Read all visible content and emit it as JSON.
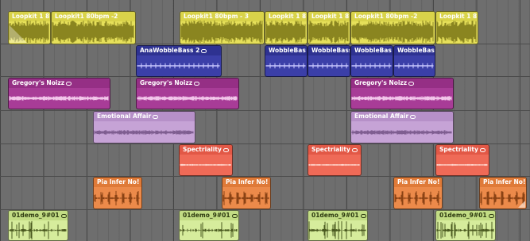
{
  "tracks": [
    {
      "id": "loopkit",
      "color": "#e6e05a",
      "header": "#d9d34a",
      "text": "#ffffff",
      "wave": "#8a8520",
      "waveKind": "dense",
      "regions": [
        {
          "label": "Loopkit 1 8"
        },
        {
          "label": "Loopkit1 80bpm -2"
        },
        {
          "label": "Loopkit1 80bpm - 3"
        },
        {
          "label": "Loopkit 1 8"
        },
        {
          "label": "Loopkit 1 8"
        },
        {
          "label": "Loopkit1 80bpm -2"
        },
        {
          "label": "Loopkit 1 8"
        }
      ]
    },
    {
      "id": "wobble",
      "color": "#3b3fa8",
      "header": "#2e3291",
      "text": "#ffffff",
      "wave": "#c9c9ff",
      "waveKind": "blips",
      "regions": [
        {
          "label": "AnaWobbleBass 2"
        },
        {
          "label": "WobbleBas"
        },
        {
          "label": "WobbleBass"
        },
        {
          "label": "WobbleBas"
        },
        {
          "label": "WobbleBas"
        }
      ]
    },
    {
      "id": "gregory",
      "color": "#a83c97",
      "header": "#952f85",
      "text": "#ffffff",
      "wave": "#f2c6ea",
      "waveKind": "thin",
      "regions": [
        {
          "label": "Gregory's Noizz"
        },
        {
          "label": "Gregory's Noizz"
        },
        {
          "label": "Gregory's Noizz"
        }
      ]
    },
    {
      "id": "emotional",
      "color": "#c6a3d6",
      "header": "#b690c8",
      "text": "#ffffff",
      "wave": "#7f5e91",
      "waveKind": "thin",
      "regions": [
        {
          "label": "Emotional Affair"
        },
        {
          "label": "Emotional Affair"
        }
      ]
    },
    {
      "id": "spectriality",
      "color": "#ef6a57",
      "header": "#e25846",
      "text": "#ffffff",
      "wave": "#ffd3ca",
      "waveKind": "flat",
      "regions": [
        {
          "label": "Spectriality"
        },
        {
          "label": "Spectriality"
        },
        {
          "label": "Spectriality"
        }
      ]
    },
    {
      "id": "pia",
      "color": "#ec8a4a",
      "header": "#df7a38",
      "text": "#ffffff",
      "wave": "#8a4214",
      "waveKind": "sparse",
      "regions": [
        {
          "label": "Pia Infer No!"
        },
        {
          "label": "Pia Infer No!"
        },
        {
          "label": "Pia Infer No!"
        },
        {
          "label": "Pia Infer No!"
        }
      ]
    },
    {
      "id": "demo",
      "color": "#d6ec9c",
      "header": "#c2dc84",
      "text": "#2d3a10",
      "wave": "#4b5a20",
      "waveKind": "spikes",
      "regions": [
        {
          "label": "01demo_9#01"
        },
        {
          "label": "01demo_9#01"
        },
        {
          "label": "01demo_9#01"
        },
        {
          "label": "01demo_9#01"
        }
      ]
    }
  ]
}
